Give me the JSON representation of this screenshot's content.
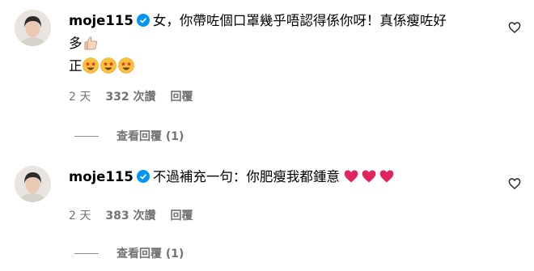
{
  "comments": [
    {
      "username": "moje115",
      "text": "女，你帶咗個口罩幾乎唔認得係你呀！真係瘦咗好多",
      "text_line1": "女，你帶咗個口罩幾乎唔認得係你呀！真係瘦咗好",
      "text_line2": "多",
      "text_line3": "正",
      "emojis": [
        "thumbs-up",
        "star-struck",
        "star-struck",
        "star-struck"
      ],
      "time": "2 天",
      "likes": "332 次讚",
      "reply_label": "回覆",
      "view_replies": "查看回覆 (1)"
    },
    {
      "username": "moje115",
      "text": "不過補充一句：你肥瘦我都鍾意",
      "emojis": [
        "red-heart",
        "red-heart",
        "red-heart"
      ],
      "time": "2 天",
      "likes": "383 次讚",
      "reply_label": "回覆",
      "view_replies": "查看回覆 (1)"
    }
  ],
  "colors": {
    "verified": "#0095f6",
    "meta_text": "#737373",
    "heart": "#e0245e"
  },
  "icons": [
    "verified-badge-icon",
    "heart-outline-icon",
    "thumbs-up-emoji",
    "star-struck-emoji",
    "red-heart-emoji"
  ]
}
